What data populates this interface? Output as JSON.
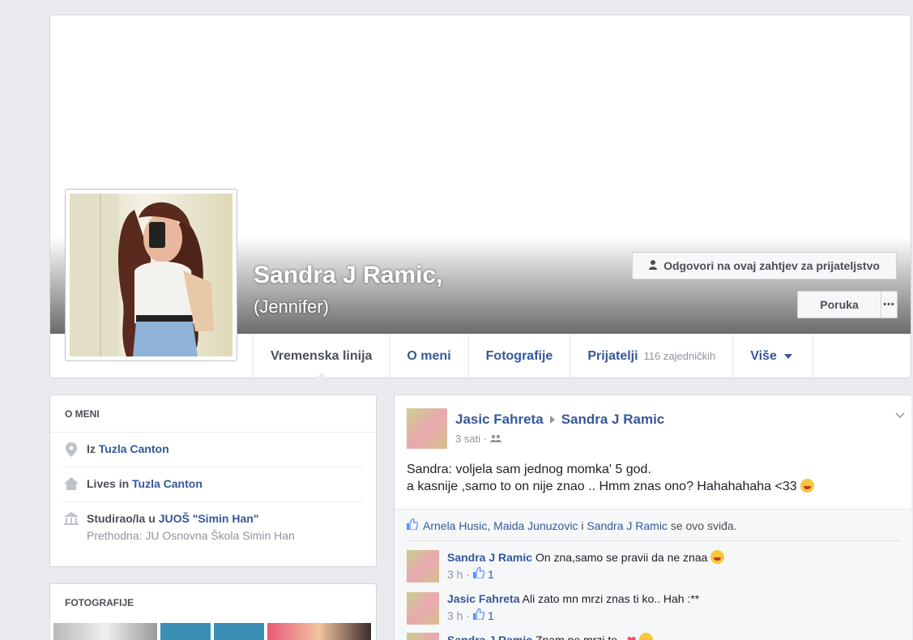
{
  "profile": {
    "name": "Sandra J Ramic,",
    "alternate_name": "(Jennifer)"
  },
  "actions": {
    "friend_request_label": "Odgovori na ovaj zahtjev za prijateljstvo",
    "message_label": "Poruka",
    "more_label": "•••"
  },
  "tabs": [
    {
      "label": "Vremenska linija",
      "sub": ""
    },
    {
      "label": "O meni",
      "sub": ""
    },
    {
      "label": "Fotografije",
      "sub": ""
    },
    {
      "label": "Prijatelji",
      "sub": "116 zajedničkih"
    },
    {
      "label": "Više",
      "sub": ""
    }
  ],
  "about": {
    "title": "O MENI",
    "rows": [
      {
        "icon": "location-pin-icon",
        "prefix": "Iz ",
        "link": "Tuzla Canton",
        "sub": ""
      },
      {
        "icon": "home-icon",
        "prefix": "Lives in ",
        "link": "Tuzla Canton",
        "sub": ""
      },
      {
        "icon": "school-icon",
        "prefix": "Studirao/la u ",
        "link": "JUOŠ \"Simin Han\"",
        "sub": "Prethodna: JU Osnovna Škola Simin Han"
      }
    ]
  },
  "photos": {
    "title": "FOTOGRAFIJE"
  },
  "post": {
    "author": "Jasic Fahreta",
    "target": "Sandra J Ramic",
    "time": "3 sati ·",
    "text_line1": "Sandra: voljela sam jednog momka' 5 god.",
    "text_line2": "a kasnije ,samo to on nije znao .. Hmm znas ono? Hahahahaha <33",
    "likes": {
      "name1": "Arnela Husic",
      "sep1": ",",
      "name2": "Maida Junuzovic",
      "conj": "i",
      "name3": "Sandra J Ramic",
      "suffix": "se ovo sviđa."
    },
    "comments": [
      {
        "name": "Sandra J Ramic",
        "text": "On zna,samo se pravii da ne znaa",
        "time": "3 h ·",
        "likes": "1"
      },
      {
        "name": "Jasic Fahreta",
        "text": "Ali zato mn mrzi znas ti ko.. Hah :**",
        "time": "3 h ·",
        "likes": "1"
      },
      {
        "name": "Sandra J Ramic",
        "text": "Znam ne mrzi te..",
        "time": "",
        "likes": ""
      }
    ]
  },
  "colors": {
    "link": "#365899",
    "background": "#e9ebee",
    "secondary_text": "#90949c"
  }
}
